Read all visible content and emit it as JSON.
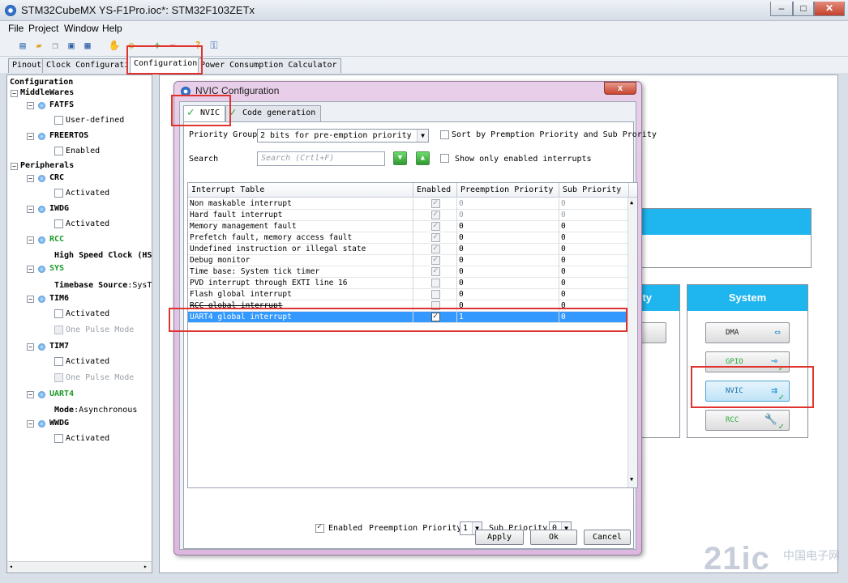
{
  "window": {
    "title": "STM32CubeMX YS-F1Pro.ioc*: STM32F103ZETx",
    "btn_min": "–",
    "btn_max": "□",
    "btn_close": "✕"
  },
  "menu": [
    "File",
    "Project",
    "Window",
    "Help"
  ],
  "toolbar_icons": [
    "new-file-icon",
    "open-folder-icon",
    "copy-icon",
    "save-icon",
    "save-all-icon",
    "hand-icon",
    "generate-icon",
    "zoom-in-icon",
    "zoom-out-icon",
    "help-icon",
    "key-icon"
  ],
  "main_tabs": [
    {
      "label": "Pinout",
      "active": false
    },
    {
      "label": "Clock Configuration",
      "active": false
    },
    {
      "label": "Configuration",
      "active": true
    },
    {
      "label": "Power Consumption Calculator",
      "active": false
    }
  ],
  "tree": {
    "root": "Configuration",
    "middlewares": "MiddleWares",
    "fatfs": "FATFS",
    "fatfs_opt": "User-defined",
    "freertos": "FREERTOS",
    "freertos_opt": "Enabled",
    "peripherals": "Peripherals",
    "crc": "CRC",
    "crc_opt": "Activated",
    "iwdg": "IWDG",
    "iwdg_opt": "Activated",
    "rcc": "RCC",
    "rcc_opt_key": "High Speed Clock (HS",
    "sys": "SYS",
    "sys_opt_key": "Timebase Source",
    "sys_opt_val": ":SysT",
    "tim6": "TIM6",
    "tim6_opt1": "Activated",
    "tim6_opt2": "One Pulse Mode",
    "tim7": "TIM7",
    "tim7_opt1": "Activated",
    "tim7_opt2": "One Pulse Mode",
    "uart4": "UART4",
    "uart4_opt_key": "Mode",
    "uart4_opt_val": ":Asynchronous",
    "wwdg": "WWDG",
    "wwdg_opt": "Activated"
  },
  "right": {
    "partial_cat": "ity",
    "system_cat": "System",
    "buttons": {
      "dma": "DMA",
      "gpio": "GPIO",
      "nvic": "NVIC",
      "rcc": "RCC"
    }
  },
  "dialog": {
    "title": "NVIC Configuration",
    "close": "x",
    "tabs": [
      {
        "label": "NVIC",
        "active": true
      },
      {
        "label": "Code generation",
        "active": false
      }
    ],
    "priority_group_label": "Priority Group",
    "priority_group_value": "2 bits for pre-emption priority ...",
    "sort_label": "Sort by Premption Priority and Sub Prority",
    "search_label": "Search",
    "search_placeholder": "Search (Crtl+F)",
    "show_only_label": "Show only enabled interrupts",
    "columns": [
      "Interrupt Table",
      "Enabled",
      "Preemption Priority",
      "Sub Priority"
    ],
    "rows": [
      {
        "name": "Non maskable interrupt",
        "enabled": true,
        "pre": "0",
        "sub": "0",
        "locked": true,
        "selected": false
      },
      {
        "name": "Hard fault interrupt",
        "enabled": true,
        "pre": "0",
        "sub": "0",
        "locked": true,
        "selected": false
      },
      {
        "name": "Memory management fault",
        "enabled": true,
        "pre": "0",
        "sub": "0",
        "locked": false,
        "selected": false
      },
      {
        "name": "Prefetch fault, memory access fault",
        "enabled": true,
        "pre": "0",
        "sub": "0",
        "locked": false,
        "selected": false
      },
      {
        "name": "Undefined instruction or illegal state",
        "enabled": true,
        "pre": "0",
        "sub": "0",
        "locked": false,
        "selected": false
      },
      {
        "name": "Debug monitor",
        "enabled": true,
        "pre": "0",
        "sub": "0",
        "locked": false,
        "selected": false
      },
      {
        "name": "Time base: System tick timer",
        "enabled": true,
        "pre": "0",
        "sub": "0",
        "locked": false,
        "selected": false
      },
      {
        "name": "PVD interrupt through EXTI line 16",
        "enabled": false,
        "pre": "0",
        "sub": "0",
        "locked": false,
        "selected": false
      },
      {
        "name": "Flash global interrupt",
        "enabled": false,
        "pre": "0",
        "sub": "0",
        "locked": false,
        "selected": false
      },
      {
        "name": "RCC global interrupt",
        "enabled": false,
        "pre": "0",
        "sub": "0",
        "locked": false,
        "selected": false
      },
      {
        "name": "UART4 global interrupt",
        "enabled": true,
        "pre": "1",
        "sub": "0",
        "locked": false,
        "selected": true
      }
    ],
    "bottom": {
      "enabled_label": "Enabled",
      "pre_label": "Preemption Priority",
      "pre_value": "1",
      "sub_label": "Sub Priority",
      "sub_value": "0"
    },
    "buttons": {
      "apply": "Apply",
      "ok": "Ok",
      "cancel": "Cancel"
    }
  },
  "watermark": {
    "main": "21ic",
    "sub": "中国电子网"
  },
  "colors": {
    "accent": "#1fb5ee",
    "selection": "#3399ff",
    "highlight": "#e0332e",
    "enabled_green": "#1f9a2a"
  }
}
